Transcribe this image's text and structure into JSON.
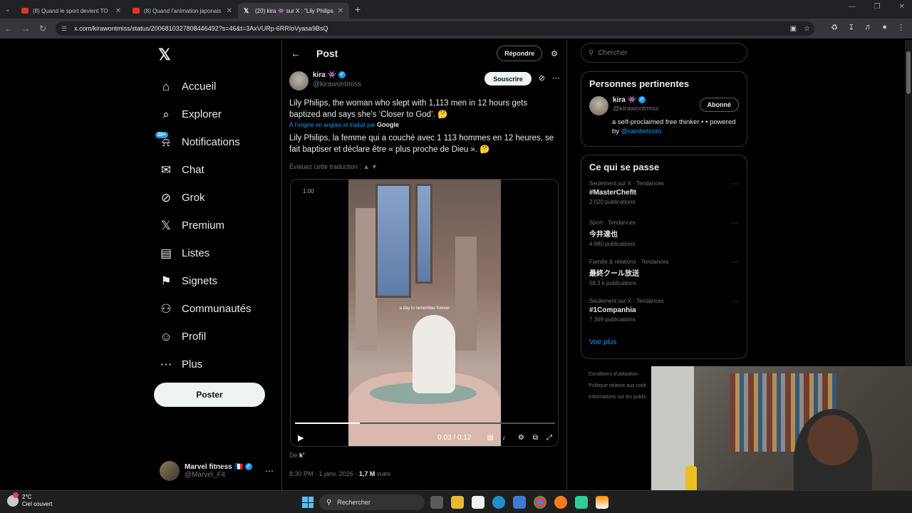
{
  "browser": {
    "tabs": [
      {
        "title": "(8) Quand le sport devient TO",
        "icon": "youtube-icon",
        "active": false
      },
      {
        "title": "(8) Quand l'animation japonais",
        "icon": "youtube-icon",
        "active": false
      },
      {
        "title": "(20) kira 👾 sur X : \"Lily Philips",
        "icon": "x-icon",
        "active": true
      }
    ],
    "url": "x.com/kirawontmiss/status/2006810327808446492?s=46&t=3AxVURp-6RRIoVyasa9BsQ"
  },
  "nav": {
    "items": [
      {
        "label": "Accueil",
        "icon": "home-icon",
        "glyph": "⌂"
      },
      {
        "label": "Explorer",
        "icon": "search-icon",
        "glyph": "⌕"
      },
      {
        "label": "Notifications",
        "icon": "bell-icon",
        "glyph": "⍾",
        "badge": "20+"
      },
      {
        "label": "Chat",
        "icon": "mail-icon",
        "glyph": "✉"
      },
      {
        "label": "Grok",
        "icon": "grok-icon",
        "glyph": "⊘"
      },
      {
        "label": "Premium",
        "icon": "x-premium-icon",
        "glyph": "𝕏"
      },
      {
        "label": "Listes",
        "icon": "list-icon",
        "glyph": "▤"
      },
      {
        "label": "Signets",
        "icon": "bookmark-icon",
        "glyph": "⚑"
      },
      {
        "label": "Communautés",
        "icon": "communities-icon",
        "glyph": "⚇"
      },
      {
        "label": "Profil",
        "icon": "profile-icon",
        "glyph": "☺"
      },
      {
        "label": "Plus",
        "icon": "more-circle-icon",
        "glyph": "⋯"
      }
    ],
    "post_button": "Poster",
    "account": {
      "name": "Marvel fitness 🇫🇷",
      "handle": "@Marvel_Fit"
    }
  },
  "post": {
    "header_title": "Post",
    "reply_button": "Répondre",
    "author_name": "kira 👾",
    "author_handle": "@kirawontmiss",
    "subscribe_button": "Souscrire",
    "text_original": "Lily Philips, the woman who slept with 1,113 men in 12 hours gets baptized and says she's ‘Closer to God’. 🤔",
    "translated_label": "À l'origine en anglais et traduit par",
    "translator": "Google",
    "text_translated": "Lily Philips, la femme qui a couché avec 1 113 hommes en 12 heures, se fait baptiser et déclare être « plus proche de Dieu ». 🤔",
    "rate_translation": "Évaluez cette traduction :",
    "video": {
      "speed": "1.00",
      "caption": "a day to remember forever",
      "time": "0:03 / 0:12",
      "progress": 0.25
    },
    "from_label": "De",
    "from_value": "k’",
    "timestamp": "8:30 PM · 1 janv. 2026 ·",
    "views_count": "1,7 M",
    "views_label": "vues"
  },
  "sidebar": {
    "search_placeholder": "Chercher",
    "relevant": {
      "title": "Personnes pertinentes",
      "name": "kira 👾",
      "handle": "@kirawontmiss",
      "follow_button": "Abonné",
      "bio": "a self-proclaimed free thinker • • powered by",
      "bio_link": "@rainbetcom"
    },
    "trends": {
      "title": "Ce qui se passe",
      "items": [
        {
          "category": "Seulement sur X · Tendances",
          "name": "#MasterChefIt",
          "count": "2 020 publications"
        },
        {
          "category": "Sport · Tendances",
          "name": "今井達也",
          "count": "4 980 publications"
        },
        {
          "category": "Famille & relations · Tendances",
          "name": "最終クール放送",
          "count": "58,3 k publications"
        },
        {
          "category": "Seulement sur X · Tendances",
          "name": "#1Companhia",
          "count": "7 369 publications"
        }
      ],
      "see_more": "Voir plus"
    },
    "footer_links": [
      "Conditions d'utilisation",
      "Politique relative aux cook",
      "Informations sur les public"
    ]
  },
  "taskbar": {
    "temperature": "2°C",
    "weather": "Ciel couvert",
    "search_label": "Rechercher"
  },
  "colors": {
    "accent": "#1d9bf0",
    "background": "#000000",
    "border": "#2f3336",
    "secondary_text": "#71767b"
  }
}
